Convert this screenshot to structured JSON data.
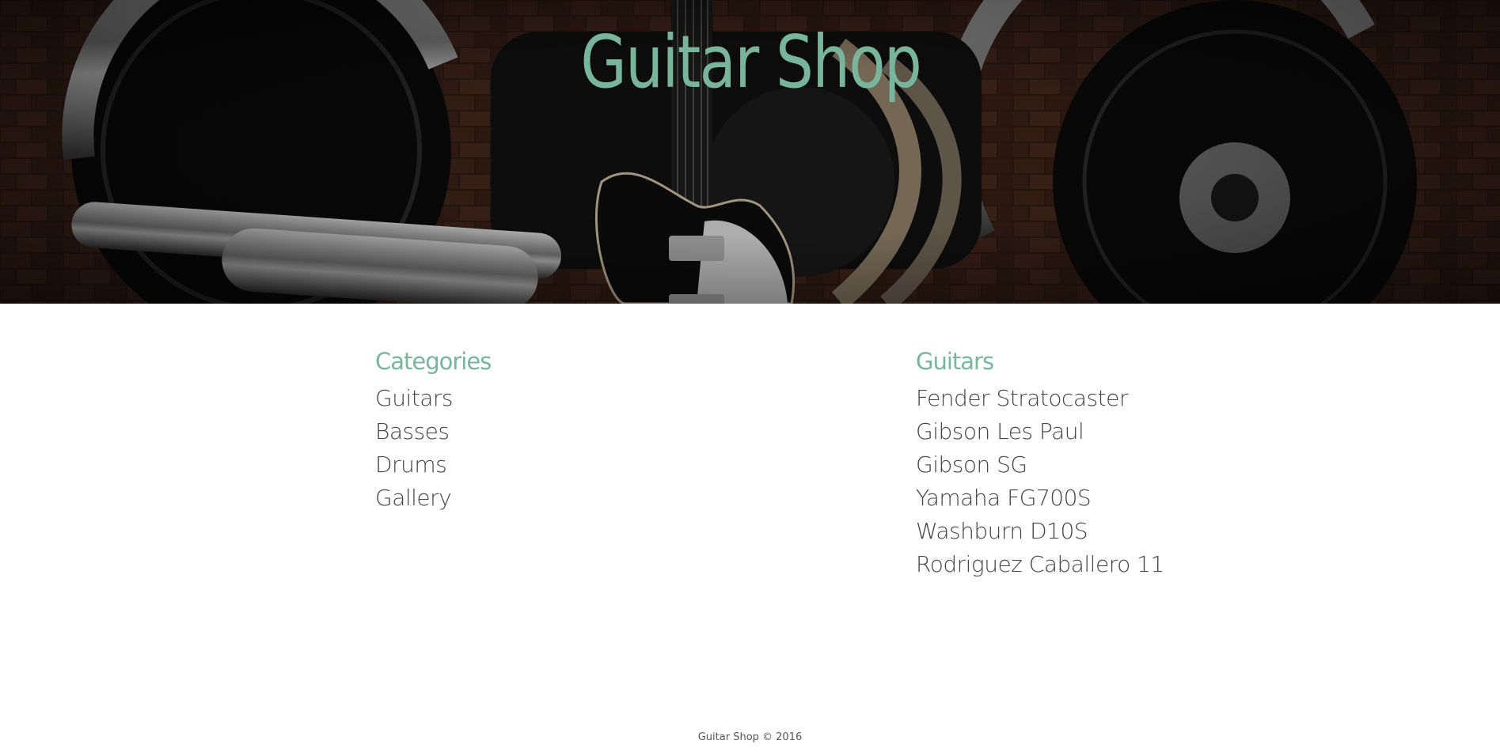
{
  "header": {
    "title": "Guitar Shop",
    "title_color": "#78b59c",
    "hero_image": "motorcycle-and-electric-guitar-against-brick-wall"
  },
  "categories": {
    "heading": "Categories",
    "items": [
      {
        "label": "Guitars"
      },
      {
        "label": "Basses"
      },
      {
        "label": "Drums"
      },
      {
        "label": "Gallery"
      }
    ]
  },
  "guitars": {
    "heading": "Guitars",
    "items": [
      {
        "label": "Fender Stratocaster"
      },
      {
        "label": "Gibson Les Paul"
      },
      {
        "label": "Gibson SG"
      },
      {
        "label": "Yamaha FG700S"
      },
      {
        "label": "Washburn D10S"
      },
      {
        "label": "Rodriguez Caballero 11"
      }
    ]
  },
  "footer": {
    "text": "Guitar Shop © 2016"
  },
  "colors": {
    "accent": "#78b59c",
    "text": "#444444",
    "background": "#ffffff"
  }
}
